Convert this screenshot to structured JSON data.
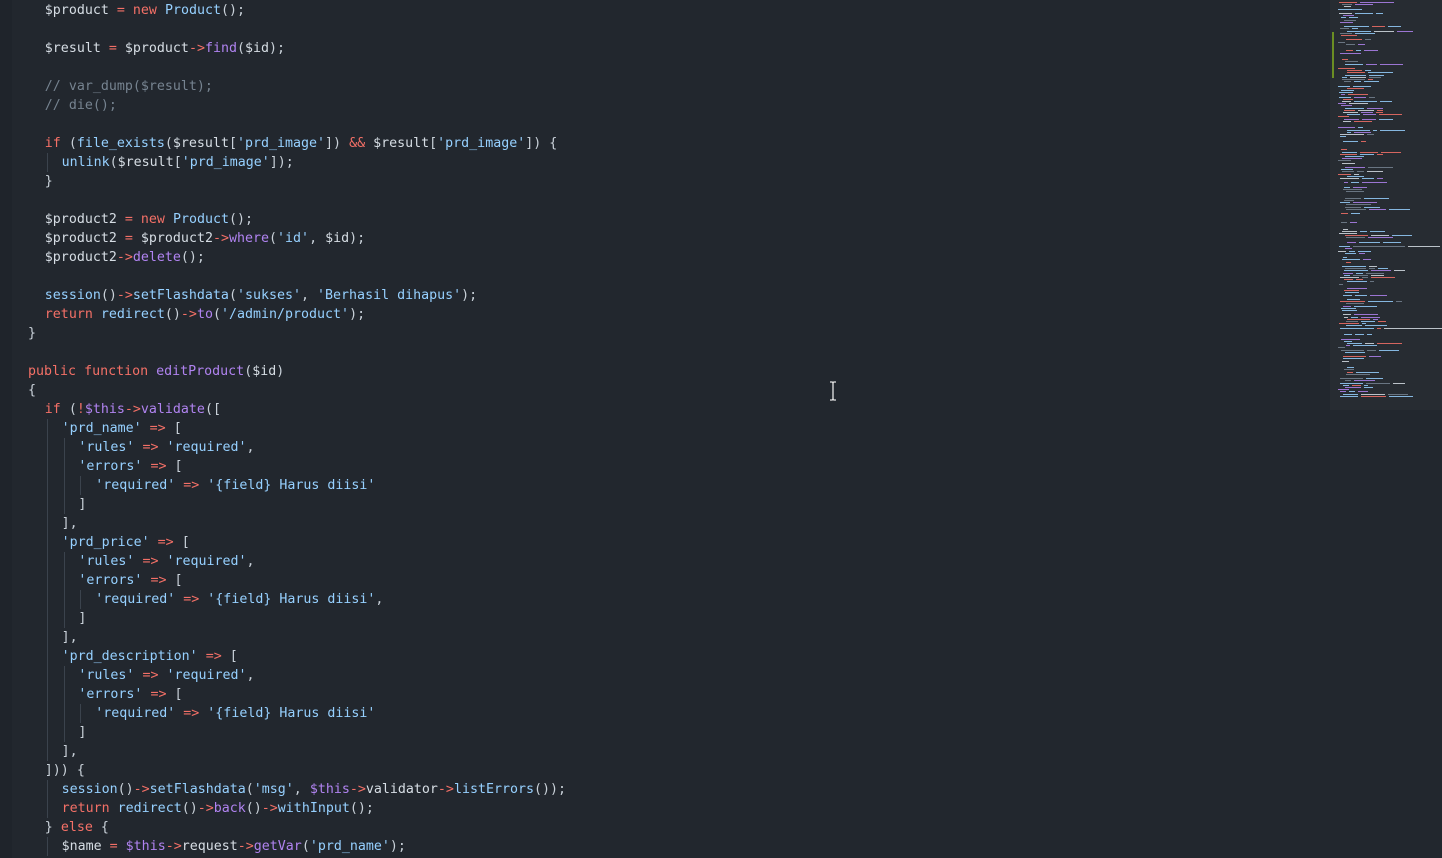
{
  "editor": {
    "language": "php",
    "lines": [
      [
        [
          "var",
          "$product"
        ],
        [
          "p",
          " "
        ],
        [
          "op",
          "="
        ],
        [
          "p",
          " "
        ],
        [
          "kw",
          "new"
        ],
        [
          "p",
          " "
        ],
        [
          "cls",
          "Product"
        ],
        [
          "p",
          "();"
        ]
      ],
      [],
      [
        [
          "var",
          "$result"
        ],
        [
          "p",
          " "
        ],
        [
          "op",
          "="
        ],
        [
          "p",
          " "
        ],
        [
          "var",
          "$product"
        ],
        [
          "op",
          "->"
        ],
        [
          "fn",
          "find"
        ],
        [
          "p",
          "("
        ],
        [
          "var",
          "$id"
        ],
        [
          "p",
          ");"
        ]
      ],
      [],
      [
        [
          "cm",
          "// var_dump($result);"
        ]
      ],
      [
        [
          "cm",
          "// die();"
        ]
      ],
      [],
      [
        [
          "kw",
          "if"
        ],
        [
          "p",
          " ("
        ],
        [
          "cls",
          "file_exists"
        ],
        [
          "p",
          "("
        ],
        [
          "var",
          "$result"
        ],
        [
          "p",
          "["
        ],
        [
          "str",
          "'prd_image'"
        ],
        [
          "p",
          "]) "
        ],
        [
          "op",
          "&&"
        ],
        [
          "p",
          " "
        ],
        [
          "var",
          "$result"
        ],
        [
          "p",
          "["
        ],
        [
          "str",
          "'prd_image'"
        ],
        [
          "p",
          "]) {"
        ]
      ],
      [
        [
          "cls",
          "unlink"
        ],
        [
          "p",
          "("
        ],
        [
          "var",
          "$result"
        ],
        [
          "p",
          "["
        ],
        [
          "str",
          "'prd_image'"
        ],
        [
          "p",
          "]);"
        ]
      ],
      [
        [
          "p",
          "}"
        ]
      ],
      [],
      [
        [
          "var",
          "$product2"
        ],
        [
          "p",
          " "
        ],
        [
          "op",
          "="
        ],
        [
          "p",
          " "
        ],
        [
          "kw",
          "new"
        ],
        [
          "p",
          " "
        ],
        [
          "cls",
          "Product"
        ],
        [
          "p",
          "();"
        ]
      ],
      [
        [
          "var",
          "$product2"
        ],
        [
          "p",
          " "
        ],
        [
          "op",
          "="
        ],
        [
          "p",
          " "
        ],
        [
          "var",
          "$product2"
        ],
        [
          "op",
          "->"
        ],
        [
          "fn",
          "where"
        ],
        [
          "p",
          "("
        ],
        [
          "str",
          "'id'"
        ],
        [
          "p",
          ", "
        ],
        [
          "var",
          "$id"
        ],
        [
          "p",
          ");"
        ]
      ],
      [
        [
          "var",
          "$product2"
        ],
        [
          "op",
          "->"
        ],
        [
          "fn",
          "delete"
        ],
        [
          "p",
          "();"
        ]
      ],
      [],
      [
        [
          "cls",
          "session"
        ],
        [
          "p",
          "()"
        ],
        [
          "op",
          "->"
        ],
        [
          "cls",
          "setFlashdata"
        ],
        [
          "p",
          "("
        ],
        [
          "str",
          "'sukses'"
        ],
        [
          "p",
          ", "
        ],
        [
          "str",
          "'Berhasil dihapus'"
        ],
        [
          "p",
          ");"
        ]
      ],
      [
        [
          "kw",
          "return"
        ],
        [
          "p",
          " "
        ],
        [
          "cls",
          "redirect"
        ],
        [
          "p",
          "()"
        ],
        [
          "op",
          "->"
        ],
        [
          "fn",
          "to"
        ],
        [
          "p",
          "("
        ],
        [
          "str",
          "'/admin/product'"
        ],
        [
          "p",
          ");"
        ]
      ],
      [
        [
          "p",
          "}"
        ]
      ],
      [],
      [
        [
          "kw",
          "public"
        ],
        [
          "p",
          " "
        ],
        [
          "kw",
          "function"
        ],
        [
          "p",
          " "
        ],
        [
          "fn",
          "editProduct"
        ],
        [
          "p",
          "("
        ],
        [
          "var",
          "$id"
        ],
        [
          "p",
          ")"
        ]
      ],
      [
        [
          "p",
          "{"
        ]
      ],
      [
        [
          "kw",
          "if"
        ],
        [
          "p",
          " ("
        ],
        [
          "op",
          "!"
        ],
        [
          "this",
          "$this"
        ],
        [
          "op",
          "->"
        ],
        [
          "fn",
          "validate"
        ],
        [
          "p",
          "(["
        ]
      ],
      [
        [
          "str",
          "'prd_name'"
        ],
        [
          "p",
          " "
        ],
        [
          "op",
          "=>"
        ],
        [
          "p",
          " ["
        ]
      ],
      [
        [
          "str",
          "'rules'"
        ],
        [
          "p",
          " "
        ],
        [
          "op",
          "=>"
        ],
        [
          "p",
          " "
        ],
        [
          "str",
          "'required'"
        ],
        [
          "p",
          ","
        ]
      ],
      [
        [
          "str",
          "'errors'"
        ],
        [
          "p",
          " "
        ],
        [
          "op",
          "=>"
        ],
        [
          "p",
          " ["
        ]
      ],
      [
        [
          "str",
          "'required'"
        ],
        [
          "p",
          " "
        ],
        [
          "op",
          "=>"
        ],
        [
          "p",
          " "
        ],
        [
          "str",
          "'{field} Harus diisi'"
        ]
      ],
      [
        [
          "p",
          "]"
        ]
      ],
      [
        [
          "p",
          "],"
        ]
      ],
      [
        [
          "str",
          "'prd_price'"
        ],
        [
          "p",
          " "
        ],
        [
          "op",
          "=>"
        ],
        [
          "p",
          " ["
        ]
      ],
      [
        [
          "str",
          "'rules'"
        ],
        [
          "p",
          " "
        ],
        [
          "op",
          "=>"
        ],
        [
          "p",
          " "
        ],
        [
          "str",
          "'required'"
        ],
        [
          "p",
          ","
        ]
      ],
      [
        [
          "str",
          "'errors'"
        ],
        [
          "p",
          " "
        ],
        [
          "op",
          "=>"
        ],
        [
          "p",
          " ["
        ]
      ],
      [
        [
          "str",
          "'required'"
        ],
        [
          "p",
          " "
        ],
        [
          "op",
          "=>"
        ],
        [
          "p",
          " "
        ],
        [
          "str",
          "'{field} Harus diisi'"
        ],
        [
          "p",
          ","
        ]
      ],
      [
        [
          "p",
          "]"
        ]
      ],
      [
        [
          "p",
          "],"
        ]
      ],
      [
        [
          "str",
          "'prd_description'"
        ],
        [
          "p",
          " "
        ],
        [
          "op",
          "=>"
        ],
        [
          "p",
          " ["
        ]
      ],
      [
        [
          "str",
          "'rules'"
        ],
        [
          "p",
          " "
        ],
        [
          "op",
          "=>"
        ],
        [
          "p",
          " "
        ],
        [
          "str",
          "'required'"
        ],
        [
          "p",
          ","
        ]
      ],
      [
        [
          "str",
          "'errors'"
        ],
        [
          "p",
          " "
        ],
        [
          "op",
          "=>"
        ],
        [
          "p",
          " ["
        ]
      ],
      [
        [
          "str",
          "'required'"
        ],
        [
          "p",
          " "
        ],
        [
          "op",
          "=>"
        ],
        [
          "p",
          " "
        ],
        [
          "str",
          "'{field} Harus diisi'"
        ]
      ],
      [
        [
          "p",
          "]"
        ]
      ],
      [
        [
          "p",
          "],"
        ]
      ],
      [
        [
          "p",
          "])) {"
        ]
      ],
      [
        [
          "cls",
          "session"
        ],
        [
          "p",
          "()"
        ],
        [
          "op",
          "->"
        ],
        [
          "cls",
          "setFlashdata"
        ],
        [
          "p",
          "("
        ],
        [
          "str",
          "'msg'"
        ],
        [
          "p",
          ", "
        ],
        [
          "this",
          "$this"
        ],
        [
          "op",
          "->"
        ],
        [
          "var",
          "validator"
        ],
        [
          "op",
          "->"
        ],
        [
          "cls",
          "listErrors"
        ],
        [
          "p",
          "());"
        ]
      ],
      [
        [
          "kw",
          "return"
        ],
        [
          "p",
          " "
        ],
        [
          "cls",
          "redirect"
        ],
        [
          "p",
          "()"
        ],
        [
          "op",
          "->"
        ],
        [
          "fn",
          "back"
        ],
        [
          "p",
          "()"
        ],
        [
          "op",
          "->"
        ],
        [
          "cls",
          "withInput"
        ],
        [
          "p",
          "();"
        ]
      ],
      [
        [
          "p",
          "} "
        ],
        [
          "kw",
          "else"
        ],
        [
          "p",
          " {"
        ]
      ],
      [
        [
          "var",
          "$name"
        ],
        [
          "p",
          " "
        ],
        [
          "op",
          "="
        ],
        [
          "p",
          " "
        ],
        [
          "this",
          "$this"
        ],
        [
          "op",
          "->"
        ],
        [
          "var",
          "request"
        ],
        [
          "op",
          "->"
        ],
        [
          "fn",
          "getVar"
        ],
        [
          "p",
          "("
        ],
        [
          "str",
          "'prd_name'"
        ],
        [
          "p",
          ");"
        ]
      ]
    ]
  },
  "colors": {
    "background": "#22272e",
    "variable": "#d6dde4",
    "operator": "#f47067",
    "keyword": "#f47067",
    "function": "#b083f0",
    "class_or_builtin": "#96d0ff",
    "string": "#96d0ff",
    "comment": "#768390",
    "this": "#b083f0",
    "punctuation": "#c9d1d9",
    "indent_guide": "#3b434d",
    "minimap_change": "#6b8e23"
  },
  "icons": {
    "cursor": "text-cursor-ibeam-icon"
  }
}
